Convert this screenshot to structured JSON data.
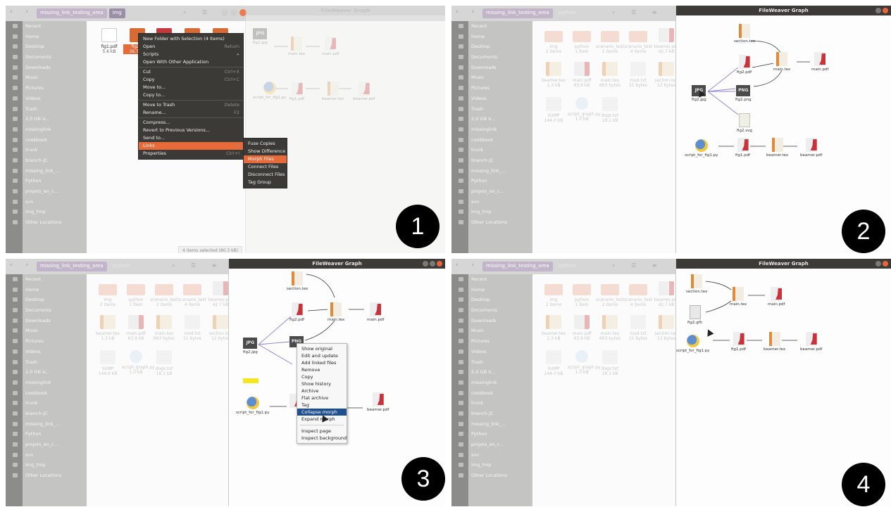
{
  "panel_numbers": [
    "1",
    "2",
    "3",
    "4"
  ],
  "file_manager": {
    "path_p1": [
      "missing_link_testing_area",
      "img"
    ],
    "path": [
      "missing_link_testing_area",
      "python"
    ],
    "sidebar": [
      "Recent",
      "Home",
      "Desktop",
      "Documents",
      "Downloads",
      "Music",
      "Pictures",
      "Videos",
      "Trash",
      "2,0 GB V...",
      "missinglink",
      "cookbook",
      "trunk",
      "branch-JC",
      "missing_link_...",
      "Python",
      "projets_en_c...",
      "svn",
      "img_tmp",
      "Other Locations"
    ],
    "sidebar_p1": [
      "Recent",
      "Home",
      "Desktop",
      "Documents",
      "Downloads",
      "Music",
      "Pictures",
      "Videos",
      "Trash",
      "2,0 GB V...",
      "missinglink",
      "cookbook",
      "trunk",
      "branch-JC",
      "missing_link_...",
      "Python",
      "projets_en_c...",
      "svn",
      "img_tmp",
      "Other Locations"
    ],
    "files_p1": [
      {
        "name": "fig1.pdf",
        "size": "5.6 kB"
      },
      {
        "name": "fig2...",
        "size": "26.7 kB"
      }
    ],
    "files_python": [
      {
        "name": "img",
        "size": "2 items",
        "kind": "folder"
      },
      {
        "name": "python",
        "size": "1 item",
        "kind": "folder"
      },
      {
        "name": "scenario_test",
        "size": "2 items",
        "kind": "folder"
      },
      {
        "name": "scenario_test",
        "size": "4 items",
        "kind": "folder"
      },
      {
        "name": "beamer.pdf",
        "size": "42.7 kB",
        "kind": "pdf"
      },
      {
        "name": "beamer.tex",
        "size": "1.3 kB",
        "kind": "tex"
      },
      {
        "name": "main.pdf",
        "size": "63.9 kB",
        "kind": "pdf"
      },
      {
        "name": "main.tex",
        "size": "663 bytes",
        "kind": "tex"
      },
      {
        "name": "mod.txt",
        "size": "11 bytes",
        "kind": "txt"
      },
      {
        "name": "section.tex",
        "size": "12 bytes",
        "kind": "tex"
      },
      {
        "name": "SUMP",
        "size": "144.0 kB",
        "kind": "txt"
      },
      {
        "name": "script_graph.py",
        "size": "1.0 kB",
        "kind": "py"
      },
      {
        "name": "dogs.txt",
        "size": "18.1 kB",
        "kind": "txt"
      }
    ],
    "status_p1": "4 items selected (80.3 kB)"
  },
  "context_menu_p1": {
    "items": [
      {
        "label": "New Folder with Selection (4 Items)",
        "shortcut": ""
      },
      {
        "label": "Open",
        "shortcut": "Return"
      },
      {
        "label": "Scripts",
        "shortcut": "▸"
      },
      {
        "label": "Open With Other Application",
        "shortcut": ""
      },
      {
        "label": "Cut",
        "shortcut": "Ctrl+X"
      },
      {
        "label": "Copy",
        "shortcut": "Ctrl+C"
      },
      {
        "label": "Move to...",
        "shortcut": ""
      },
      {
        "label": "Copy to...",
        "shortcut": ""
      },
      {
        "label": "Move to Trash",
        "shortcut": "Delete"
      },
      {
        "label": "Rename...",
        "shortcut": "F2"
      },
      {
        "label": "Compress...",
        "shortcut": ""
      },
      {
        "label": "Revert to Previous Versions...",
        "shortcut": ""
      },
      {
        "label": "Send to...",
        "shortcut": ""
      },
      {
        "label": "Links",
        "shortcut": "▸"
      },
      {
        "label": "Properties",
        "shortcut": "Ctrl+I"
      }
    ],
    "submenu": [
      "Fuse Copies",
      "Show Difference",
      "Morph Files",
      "Connect Files",
      "Disconnect Files",
      "Tag Group"
    ]
  },
  "graph": {
    "title": "FileWeaver Graph",
    "nodes": {
      "section_tex": "section.tex",
      "fig2_pdf": "fig2.pdf",
      "main_tex": "main.tex",
      "main_pdf": "main.pdf",
      "fig2_jpg": "fig2.jpg",
      "fig2_png": "fig2.png",
      "fig2_svg": "fig2.svg",
      "script": "script_for_fig1.py",
      "fig1_pdf": "fig1.pdf",
      "beamer_tex": "beamer.tex",
      "beamer_pdf": "beamer.pdf",
      "fig2_gfh": "fig2.gfh"
    },
    "icon_labels": {
      "jpg": "JPG",
      "png": "PNG"
    }
  },
  "context_menu_p3": {
    "items": [
      "Show original",
      "Edit and update",
      "Add linked files",
      "Remove",
      "Copy",
      "Show history",
      "Archive",
      "Flat archive",
      "Tag",
      "Collapse morph",
      "Expand morph"
    ],
    "items2": [
      "Inspect page",
      "Inspect background"
    ]
  }
}
